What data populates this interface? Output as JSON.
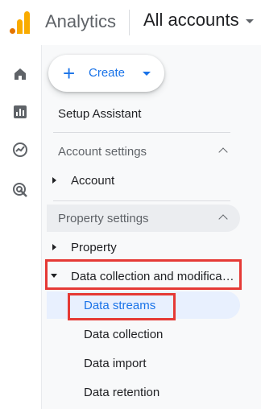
{
  "header": {
    "app_title": "Analytics",
    "account_selector": "All accounts",
    "logo_colors": [
      "#e37400",
      "#f9ab00",
      "#f9ab00"
    ]
  },
  "rail": {
    "icons": [
      "home-icon",
      "reports-icon",
      "explore-icon",
      "advertising-icon"
    ]
  },
  "create_button": {
    "label": "Create",
    "accent": "#1a73e8"
  },
  "sidebar": {
    "setup_assistant": "Setup Assistant",
    "account_settings": {
      "label": "Account settings",
      "items": [
        {
          "label": "Account"
        }
      ]
    },
    "property_settings": {
      "label": "Property settings",
      "items": [
        {
          "label": "Property"
        },
        {
          "label": "Data collection and modifica…"
        }
      ],
      "sub_items": [
        {
          "label": "Data streams",
          "active": true
        },
        {
          "label": "Data collection"
        },
        {
          "label": "Data import"
        },
        {
          "label": "Data retention"
        }
      ]
    }
  },
  "colors": {
    "highlight_red": "#e53935",
    "active_blue": "#1a73e8"
  }
}
